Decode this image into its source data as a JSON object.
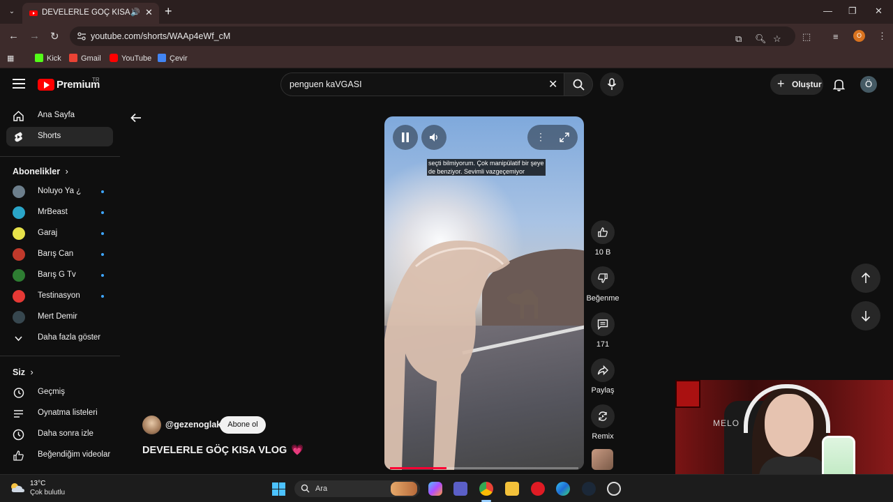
{
  "browser": {
    "tab_title": "DEVELERLE GÖÇ KISA VLOG",
    "url": "youtube.com/shorts/WAAp4eWf_cM",
    "profile_initial": "O",
    "bookmarks": [
      "Kick",
      "Gmail",
      "YouTube",
      "Çevir"
    ]
  },
  "header": {
    "logo_text": "Premium",
    "logo_region": "TR",
    "search_value": "penguen kaVGASI",
    "create_label": "Oluştur",
    "avatar_initial": "Ö"
  },
  "sidebar": {
    "main": [
      {
        "label": "Ana Sayfa",
        "icon": "home-icon"
      },
      {
        "label": "Shorts",
        "icon": "shorts-icon",
        "active": true
      }
    ],
    "subscriptions_heading": "Abonelikler",
    "subscriptions": [
      {
        "label": "Noluyo Ya ¿",
        "color": "#6d7f8c"
      },
      {
        "label": "MrBeast",
        "color": "#2aa5c8"
      },
      {
        "label": "Garaj",
        "color": "#e7e24a"
      },
      {
        "label": "Barış Can",
        "color": "#c0392b"
      },
      {
        "label": "Barış G Tv",
        "color": "#2e7d32"
      },
      {
        "label": "Testinasyon",
        "color": "#e53935"
      },
      {
        "label": "Mert Demir",
        "color": "#37474f"
      }
    ],
    "show_more": "Daha fazla göster",
    "you_heading": "Siz",
    "you_items": [
      {
        "label": "Geçmiş",
        "icon": "history-icon"
      },
      {
        "label": "Oynatma listeleri",
        "icon": "playlist-icon"
      },
      {
        "label": "Daha sonra izle",
        "icon": "clock-icon"
      },
      {
        "label": "Beğendiğim videolar",
        "icon": "like-icon"
      }
    ]
  },
  "video": {
    "caption": "seçti bilmiyorum. Çok manipülatif bir şeye de benziyor. Sevimli vazgeçemiyor",
    "progress": 0.3
  },
  "actions": {
    "likes": "10 B",
    "dislike": "Beğenme",
    "comments": "171",
    "share": "Paylaş",
    "remix": "Remix"
  },
  "channel": {
    "name": "@gezenoglak",
    "subscribe": "Abone ol"
  },
  "title": "DEVELERLE GÖÇ KISA VLOG",
  "title_emoji": "💗",
  "webcam": {
    "sign_text": "MELO"
  },
  "taskbar": {
    "temperature": "13°C",
    "condition": "Çok bulutlu",
    "search_label": "Ara"
  }
}
